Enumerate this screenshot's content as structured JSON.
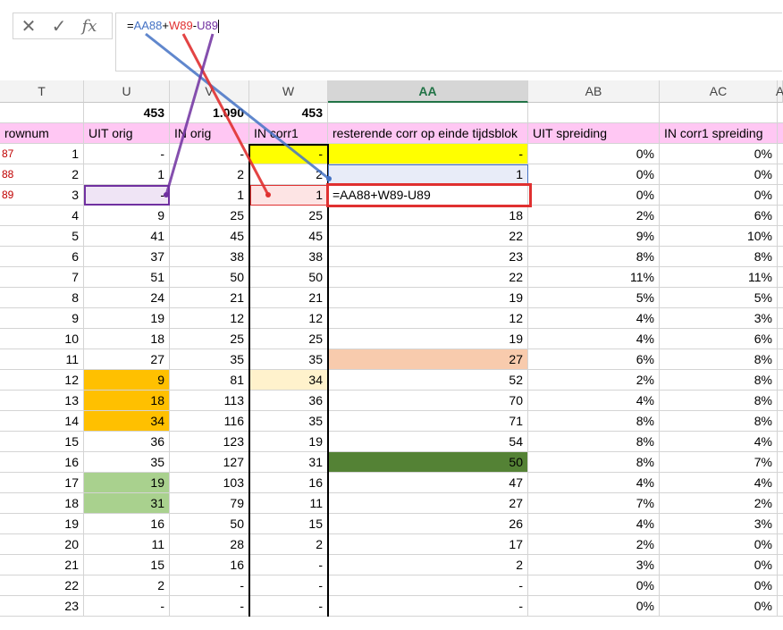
{
  "formula_bar": {
    "cancel_icon": "x-icon",
    "enter_icon": "check-icon",
    "fx_label": "fx",
    "formula_parts": [
      "=",
      "AA88",
      "+",
      "W89",
      "-",
      "U89"
    ]
  },
  "columns": [
    "T",
    "U",
    "V",
    "W",
    "AA",
    "AB",
    "AC",
    "A"
  ],
  "selected_column": "AA",
  "totals_row": {
    "U": "453",
    "V": "1.090",
    "W": "453"
  },
  "headers": {
    "T": "rownum",
    "U": "UIT orig",
    "V": "IN orig",
    "W": "IN corr1",
    "AA": "resterende corr op einde tijdsblok",
    "AB": "UIT spreiding",
    "AC": "IN corr1 spreiding"
  },
  "row_labels": [
    "87",
    "88",
    "89"
  ],
  "rows": [
    {
      "T": "1",
      "U": "-",
      "V": "-",
      "W": "-",
      "AA": "-",
      "AB": "0%",
      "AC": "0%"
    },
    {
      "T": "2",
      "U": "1",
      "V": "2",
      "W": "2",
      "AA": "1",
      "AB": "0%",
      "AC": "0%"
    },
    {
      "T": "3",
      "U": "-",
      "V": "1",
      "W": "1",
      "AA": "=AA88+W89-U89",
      "AB": "0%",
      "AC": "0%"
    },
    {
      "T": "4",
      "U": "9",
      "V": "25",
      "W": "25",
      "AA": "18",
      "AB": "2%",
      "AC": "6%"
    },
    {
      "T": "5",
      "U": "41",
      "V": "45",
      "W": "45",
      "AA": "22",
      "AB": "9%",
      "AC": "10%"
    },
    {
      "T": "6",
      "U": "37",
      "V": "38",
      "W": "38",
      "AA": "23",
      "AB": "8%",
      "AC": "8%"
    },
    {
      "T": "7",
      "U": "51",
      "V": "50",
      "W": "50",
      "AA": "22",
      "AB": "11%",
      "AC": "11%"
    },
    {
      "T": "8",
      "U": "24",
      "V": "21",
      "W": "21",
      "AA": "19",
      "AB": "5%",
      "AC": "5%"
    },
    {
      "T": "9",
      "U": "19",
      "V": "12",
      "W": "12",
      "AA": "12",
      "AB": "4%",
      "AC": "3%"
    },
    {
      "T": "10",
      "U": "18",
      "V": "25",
      "W": "25",
      "AA": "19",
      "AB": "4%",
      "AC": "6%"
    },
    {
      "T": "11",
      "U": "27",
      "V": "35",
      "W": "35",
      "AA": "27",
      "AB": "6%",
      "AC": "8%"
    },
    {
      "T": "12",
      "U": "9",
      "V": "81",
      "W": "34",
      "AA": "52",
      "AB": "2%",
      "AC": "8%"
    },
    {
      "T": "13",
      "U": "18",
      "V": "113",
      "W": "36",
      "AA": "70",
      "AB": "4%",
      "AC": "8%"
    },
    {
      "T": "14",
      "U": "34",
      "V": "116",
      "W": "35",
      "AA": "71",
      "AB": "8%",
      "AC": "8%"
    },
    {
      "T": "15",
      "U": "36",
      "V": "123",
      "W": "19",
      "AA": "54",
      "AB": "8%",
      "AC": "4%"
    },
    {
      "T": "16",
      "U": "35",
      "V": "127",
      "W": "31",
      "AA": "50",
      "AB": "8%",
      "AC": "7%"
    },
    {
      "T": "17",
      "U": "19",
      "V": "103",
      "W": "16",
      "AA": "47",
      "AB": "4%",
      "AC": "4%"
    },
    {
      "T": "18",
      "U": "31",
      "V": "79",
      "W": "11",
      "AA": "27",
      "AB": "7%",
      "AC": "2%"
    },
    {
      "T": "19",
      "U": "16",
      "V": "50",
      "W": "15",
      "AA": "26",
      "AB": "4%",
      "AC": "3%"
    },
    {
      "T": "20",
      "U": "11",
      "V": "28",
      "W": "2",
      "AA": "17",
      "AB": "2%",
      "AC": "0%"
    },
    {
      "T": "21",
      "U": "15",
      "V": "16",
      "W": "-",
      "AA": "2",
      "AB": "3%",
      "AC": "0%"
    },
    {
      "T": "22",
      "U": "2",
      "V": "-",
      "W": "-",
      "AA": "-",
      "AB": "0%",
      "AC": "0%"
    },
    {
      "T": "23",
      "U": "-",
      "V": "-",
      "W": "-",
      "AA": "-",
      "AB": "0%",
      "AC": "0%"
    }
  ],
  "colors": {
    "header_pink": "#ffc7f3",
    "yellow": "#ffff00",
    "orange": "#ffc000",
    "light_orange": "#fff2cc",
    "salmon": "#f8cbad",
    "green": "#a9d18e",
    "dark_green": "#548235",
    "ref_blue": "#4472c4",
    "ref_red": "#e03030",
    "ref_purple": "#7030a0",
    "ref_blue_fill": "#e8ecf8",
    "ref_red_fill": "#fde4e4",
    "ref_purple_fill": "#efe4f5",
    "active_red_border": "#e03030"
  }
}
